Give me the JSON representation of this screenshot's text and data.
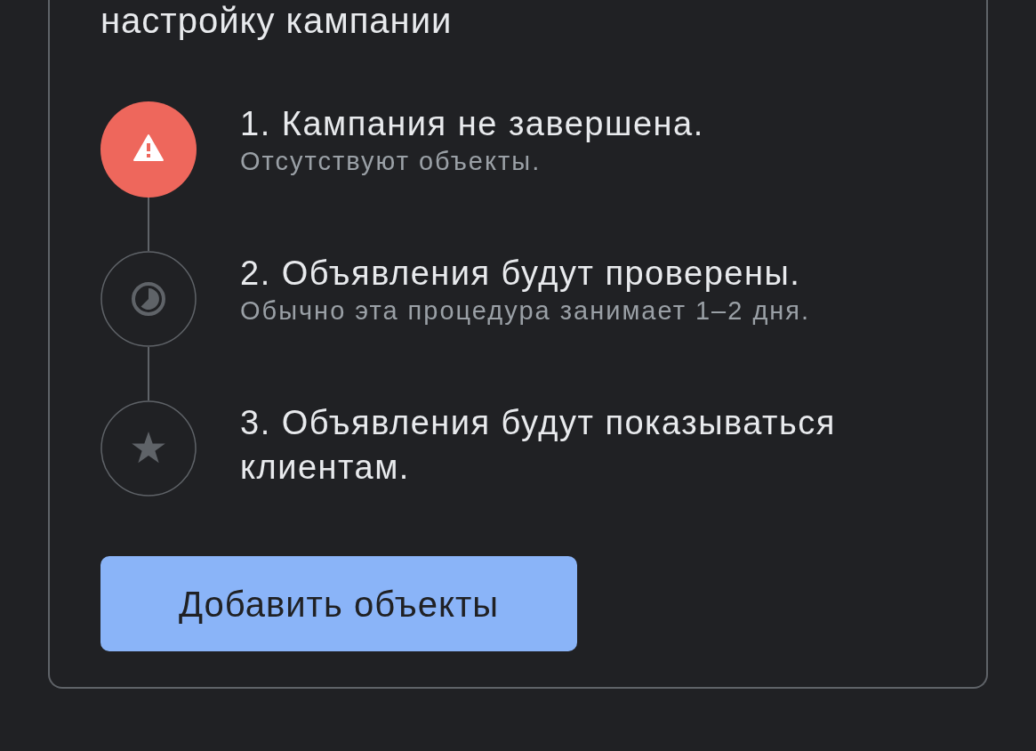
{
  "card": {
    "title": "настройку кампании",
    "steps": [
      {
        "kind": "warning",
        "title": "1. Кампания не завершена.",
        "subtitle": "Отсутствуют объекты."
      },
      {
        "kind": "pending",
        "title": "2. Объявления будут проверены.",
        "subtitle": "Обычно эта процедура занимает 1–2 дня."
      },
      {
        "kind": "star",
        "title": "3. Объявления будут показываться клиентам."
      }
    ],
    "button": {
      "label": "Добавить объекты"
    }
  }
}
